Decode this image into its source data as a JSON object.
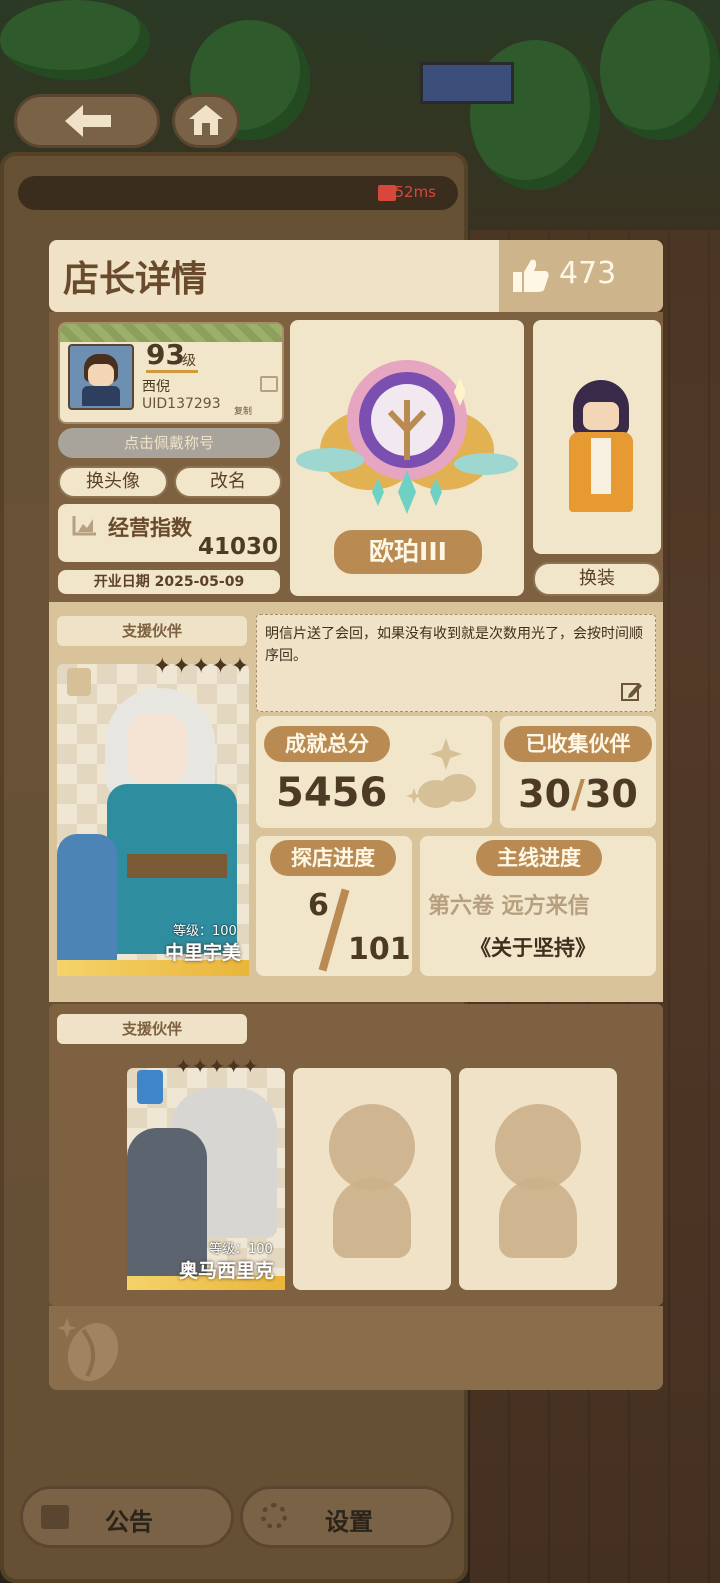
{
  "status": {
    "ping": "52ms"
  },
  "header": {
    "title": "店长详情",
    "likes": "473"
  },
  "profile": {
    "level": "93",
    "level_unit": "级",
    "name": "西倪",
    "uid": "UID137293",
    "copy_label": "复制",
    "title_button": "点击佩戴称号",
    "change_avatar": "换头像",
    "rename": "改名",
    "business_label": "经营指数",
    "business_value": "41030",
    "open_date": "开业日期 2025-05-09"
  },
  "badge": {
    "name": "欧珀III"
  },
  "outfit": {
    "button": "换装"
  },
  "support": {
    "tag": "支援伙伴",
    "partner_level": "等级：100",
    "partner_name": "中里宇美",
    "message": "明信片送了会回，如果没有收到就是次数用光了，会按时间顺序回。"
  },
  "stats": {
    "achievement_label": "成就总分",
    "achievement_value": "5456",
    "collected_label": "已收集伙伴",
    "collected_value": "30",
    "collected_sep": "/",
    "collected_total": "30",
    "explore_label": "探店进度",
    "explore_value": "6",
    "explore_total": "101",
    "main_label": "主线进度",
    "main_chapter": "第六卷 远方来信",
    "main_title": "《关于坚持》"
  },
  "support2": {
    "tag": "支援伙伴",
    "partner_level": "等级：100",
    "partner_name": "奥马西里克"
  },
  "bottom_nav": {
    "notice": "公告",
    "settings": "设置"
  },
  "colors": {
    "panel": "#7d6140",
    "card": "#f1e5ca",
    "accent": "#b98b52",
    "ping": "#d8473b"
  }
}
